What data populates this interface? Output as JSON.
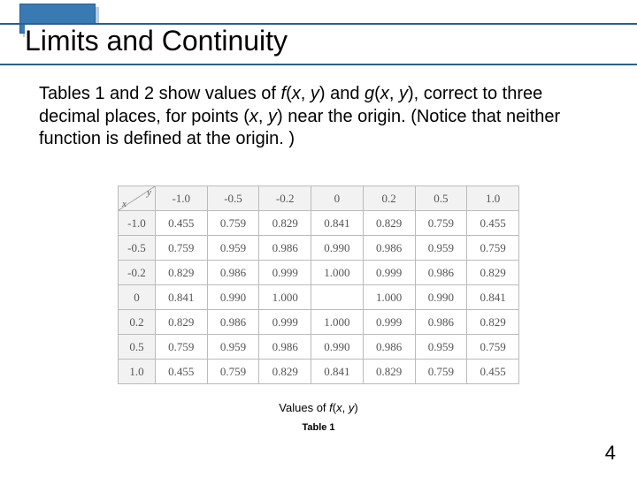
{
  "title": "Limits and Continuity",
  "body": {
    "t1": "Tables 1 and 2 show values of ",
    "f1": "f",
    "t2": "(",
    "v1": "x",
    "t3": ", ",
    "v2": "y",
    "t4": ") and ",
    "f2": "g",
    "t5": "(",
    "v3": "x",
    "t6": ", ",
    "v4": "y",
    "t7": "), correct to three decimal places, for points (",
    "v5": "x",
    "t8": ", ",
    "v6": "y",
    "t9": ") near the origin. (Notice that neither function is defined at the origin. )"
  },
  "diag": {
    "y": "y",
    "x": "x"
  },
  "chart_data": {
    "type": "table",
    "title": "Values of f(x, y)",
    "subtitle": "Table 1",
    "columns": [
      "-1.0",
      "-0.5",
      "-0.2",
      "0",
      "0.2",
      "0.5",
      "1.0"
    ],
    "rows": [
      "-1.0",
      "-0.5",
      "-0.2",
      "0",
      "0.2",
      "0.5",
      "1.0"
    ],
    "values": [
      [
        "0.455",
        "0.759",
        "0.829",
        "0.841",
        "0.829",
        "0.759",
        "0.455"
      ],
      [
        "0.759",
        "0.959",
        "0.986",
        "0.990",
        "0.986",
        "0.959",
        "0.759"
      ],
      [
        "0.829",
        "0.986",
        "0.999",
        "1.000",
        "0.999",
        "0.986",
        "0.829"
      ],
      [
        "0.841",
        "0.990",
        "1.000",
        "",
        "1.000",
        "0.990",
        "0.841"
      ],
      [
        "0.829",
        "0.986",
        "0.999",
        "1.000",
        "0.999",
        "0.986",
        "0.829"
      ],
      [
        "0.759",
        "0.959",
        "0.986",
        "0.990",
        "0.986",
        "0.959",
        "0.759"
      ],
      [
        "0.455",
        "0.759",
        "0.829",
        "0.841",
        "0.829",
        "0.759",
        "0.455"
      ]
    ]
  },
  "caption": {
    "prefix": "Values of ",
    "fn": "f",
    "paren_open": "(",
    "x": "x",
    "comma": ", ",
    "y": "y",
    "paren_close": ")"
  },
  "table_label": "Table 1",
  "page_number": "4"
}
